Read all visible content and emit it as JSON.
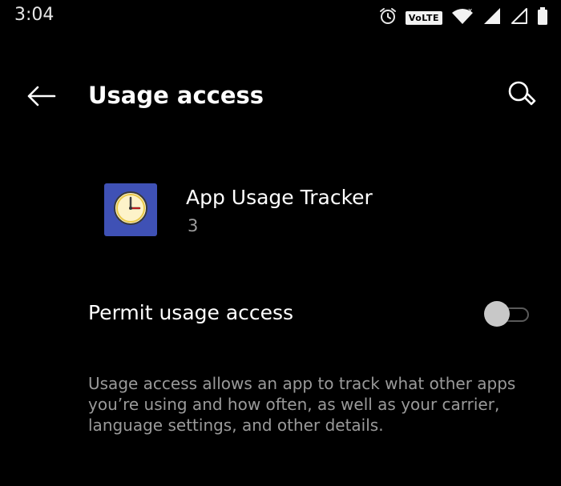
{
  "status_bar": {
    "time": "3:04",
    "volte_label": "VoLTE",
    "icons": [
      "alarm-icon",
      "volte-badge",
      "wifi-icon",
      "cell-signal-icon",
      "cell-signal-empty-icon",
      "battery-icon"
    ]
  },
  "toolbar": {
    "title": "Usage access",
    "back_icon": "arrow-left-icon",
    "search_icon": "search-icon"
  },
  "app": {
    "name": "App Usage Tracker",
    "subtitle": "3",
    "icon": "clock-icon",
    "icon_bg": "#3f51b5"
  },
  "permit": {
    "label": "Permit usage access",
    "enabled": false
  },
  "description": "Usage access allows an app to track what other apps you’re using and how often, as well as your carrier, language settings, and other details.",
  "colors": {
    "background": "#000000",
    "primary_text": "#ffffff",
    "secondary_text": "#9a9a9a",
    "switch_thumb_off": "#c8c8c8"
  }
}
